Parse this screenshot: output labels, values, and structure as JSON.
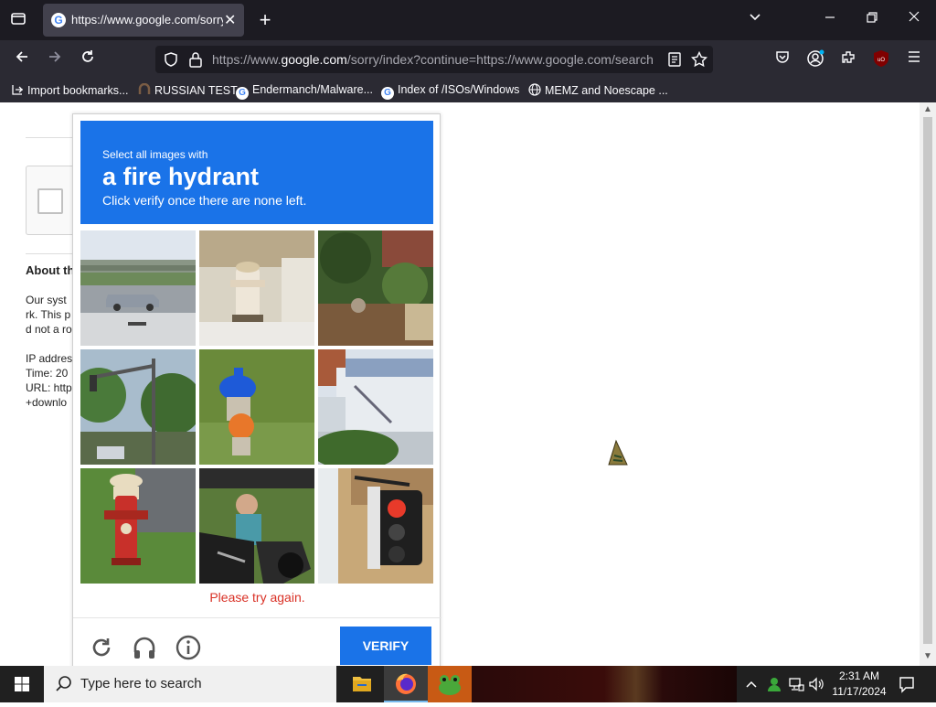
{
  "browser": {
    "tab_title": "https://www.google.com/sorry/index?continue=https://www.google.com/search",
    "url_prefix": "https://www.",
    "url_domain": "google.com",
    "url_rest": "/sorry/index?continue=https://www.google.com/search",
    "bookmarks": [
      {
        "label": "Import bookmarks...",
        "icon": "import-icon"
      },
      {
        "label": "RUSSIAN TEST",
        "icon": "site-icon"
      },
      {
        "label": "Endermanch/Malware...",
        "icon": "google-icon"
      },
      {
        "label": "Index of /ISOs/Windows",
        "icon": "google-icon"
      },
      {
        "label": "MEMZ and Noescape ...",
        "icon": "globe-icon"
      }
    ]
  },
  "page_bg": {
    "about": "About th",
    "lines": [
      "Our syst",
      "rk. This p",
      "d not a ro",
      "",
      "IP addres",
      "Time: 20",
      "URL: http",
      "+downlo"
    ]
  },
  "captcha": {
    "instruction_top": "Select all images with",
    "target": "a fire hydrant",
    "instruction_bottom": "Click verify once there are none left.",
    "error": "Please try again.",
    "verify_label": "VERIFY",
    "tiles": [
      "highway-car",
      "fire-hydrant-white",
      "garden-path",
      "traffic-light-street",
      "fire-hydrant-blue-orange",
      "building-stairs",
      "fire-hydrant-red",
      "person-motorcycle",
      "traffic-light-closeup"
    ]
  },
  "taskbar": {
    "search_placeholder": "Type here to search",
    "time": "2:31 AM",
    "date": "11/17/2024"
  },
  "colors": {
    "accent": "#1a73e8",
    "error": "#d93025",
    "chrome_dark": "#1c1b22",
    "chrome": "#2b2a33"
  }
}
